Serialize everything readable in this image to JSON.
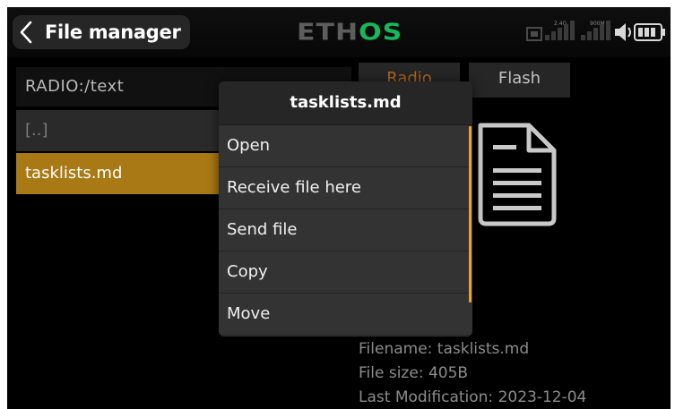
{
  "header": {
    "title": "File manager",
    "brand_main": "ETH",
    "brand_accent": "OS",
    "signal_2g4": "2.4G",
    "signal_900m": "900M",
    "icons": [
      "back-chevron-icon",
      "telemetry-icon",
      "signal-2g4-icon",
      "signal-900m-icon",
      "audio-speaker-icon",
      "battery-icon"
    ]
  },
  "file_list": {
    "path": "RADIO:/text",
    "items": [
      {
        "label": "[..]",
        "selected": false
      },
      {
        "label": "tasklists.md",
        "selected": true
      }
    ]
  },
  "tabs": [
    {
      "label": "Radio",
      "active": true
    },
    {
      "label": "Flash",
      "active": false
    }
  ],
  "file_info": {
    "icon": "document-icon",
    "filename": "Filename: tasklists.md",
    "size": "File size: 405B",
    "modified": "Last Modification: 2023-12-04"
  },
  "popup": {
    "title": "tasklists.md",
    "items": [
      "Open",
      "Receive file here",
      "Send file",
      "Copy",
      "Move"
    ]
  },
  "colors": {
    "accent": "#a87914",
    "brand_green": "#16b85a",
    "scrollbar": "#e9a52a",
    "background": "#000000"
  }
}
